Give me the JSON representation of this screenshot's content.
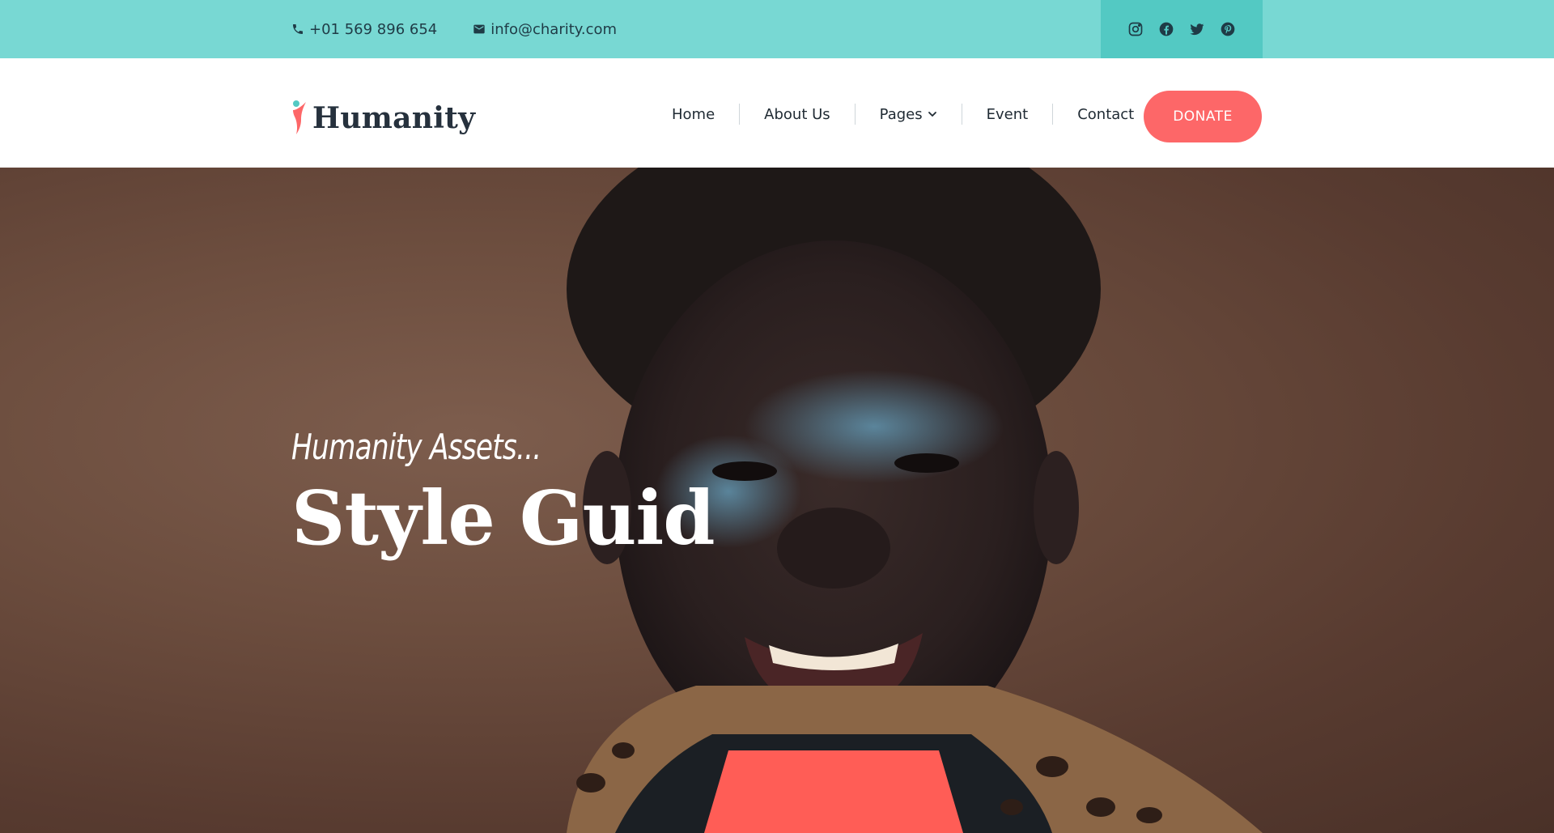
{
  "topbar": {
    "phone": "+01 569 896 654",
    "email": "info@charity.com",
    "social": [
      "instagram-icon",
      "facebook-icon",
      "twitter-icon",
      "pinterest-icon"
    ]
  },
  "header": {
    "logo_text": "Humanity",
    "nav": [
      {
        "label": "Home"
      },
      {
        "label": "About Us"
      },
      {
        "label": "Pages"
      },
      {
        "label": "Event"
      },
      {
        "label": "Contact"
      }
    ],
    "donate_label": "DONATE"
  },
  "hero": {
    "subtitle": "Humanity Assets...",
    "title": "Style Guid"
  },
  "colors": {
    "topbar": "#78d8d3",
    "social_box": "#53c9c3",
    "accent": "#fd6768",
    "text_dark": "#1f2a33"
  }
}
